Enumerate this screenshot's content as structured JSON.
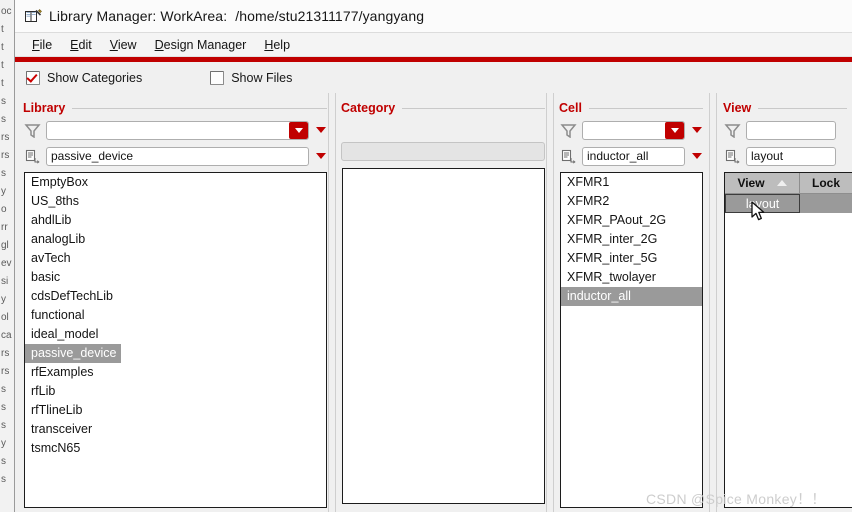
{
  "window": {
    "icon": "book-library-icon",
    "title": "Library Manager: WorkArea:",
    "path": "/home/stu21311177/yangyang"
  },
  "menu": {
    "items": [
      {
        "name": "file",
        "label": "File",
        "mnemonic": "F",
        "rest": "ile"
      },
      {
        "name": "edit",
        "label": "Edit",
        "mnemonic": "E",
        "rest": "dit"
      },
      {
        "name": "view",
        "label": "View",
        "mnemonic": "V",
        "rest": "iew"
      },
      {
        "name": "design-manager",
        "label": "Design Manager",
        "mnemonic": "D",
        "rest": "esign Manager"
      },
      {
        "name": "help",
        "label": "Help",
        "mnemonic": "H",
        "rest": "elp"
      }
    ]
  },
  "toolbar": {
    "show_categories": {
      "label": "Show Categories",
      "checked": true
    },
    "show_files": {
      "label": "Show Files",
      "checked": false
    }
  },
  "colors": {
    "accent_red": "#c00000",
    "selection_gray": "#9a9a9a",
    "panel_bg": "#f0f0f0",
    "header_gray": "#bdbdbd"
  },
  "panels": {
    "library": {
      "title": "Library",
      "filter_value": "",
      "filter_placeholder": "",
      "name_value": "passive_device",
      "items": [
        "EmptyBox",
        "US_8ths",
        "ahdlLib",
        "analogLib",
        "avTech",
        "basic",
        "cdsDefTechLib",
        "functional",
        "ideal_model",
        "passive_device",
        "rfExamples",
        "rfLib",
        "rfTlineLib",
        "transceiver",
        "tsmcN65"
      ],
      "selected": "passive_device"
    },
    "category": {
      "title": "Category",
      "items": [],
      "selected": ""
    },
    "cell": {
      "title": "Cell",
      "filter_value": "",
      "filter_placeholder": "",
      "name_value": "inductor_all",
      "items": [
        "XFMR1",
        "XFMR2",
        "XFMR_PAout_2G",
        "XFMR_inter_2G",
        "XFMR_inter_5G",
        "XFMR_twolayer",
        "inductor_all"
      ],
      "selected": "inductor_all"
    },
    "view": {
      "title": "View",
      "filter_value": "",
      "filter_placeholder": "",
      "name_value": "layout",
      "columns": [
        "View",
        "Lock"
      ],
      "sort_column": "View",
      "sort_direction": "ascending",
      "rows": [
        {
          "view": "layout",
          "lock": ""
        }
      ],
      "selected": "layout"
    }
  },
  "background_window": {
    "fragments": [
      "oc",
      "t",
      "t",
      "t",
      "t",
      "s",
      "s",
      "rs",
      "rs",
      "s",
      "y",
      "o",
      "rr",
      "gl",
      "ev",
      "si",
      "y",
      "ol",
      "ca",
      "rs",
      "rs",
      "s",
      "s",
      "s",
      "y",
      "s",
      "s"
    ]
  },
  "watermark": {
    "text": "CSDN @Spice Monkey！！"
  }
}
